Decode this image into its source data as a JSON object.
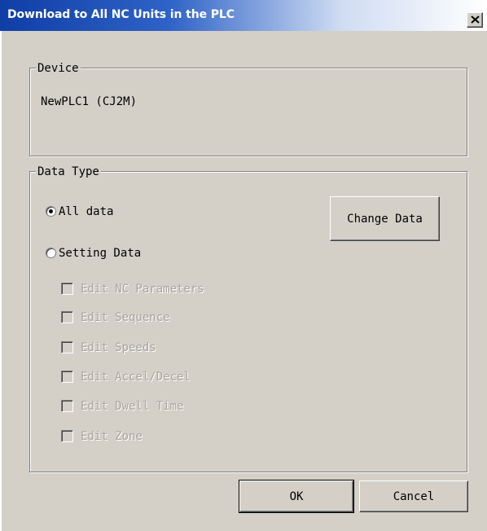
{
  "dialog": {
    "title": "Download to All NC Units in the PLC",
    "close_glyph": "close-icon"
  },
  "device_group": {
    "legend": "Device",
    "value": "NewPLC1 (CJ2M)"
  },
  "data_type_group": {
    "legend": "Data Type",
    "radio_options": [
      {
        "label": "All data",
        "selected": true
      },
      {
        "label": "Setting Data",
        "selected": false
      }
    ],
    "change_data_label": "Change Data",
    "checkboxes": [
      {
        "label": "Edit NC Parameters",
        "checked": false,
        "enabled": false
      },
      {
        "label": "Edit Sequence",
        "checked": false,
        "enabled": false
      },
      {
        "label": "Edit Speeds",
        "checked": false,
        "enabled": false
      },
      {
        "label": "Edit Accel/Decel",
        "checked": false,
        "enabled": false
      },
      {
        "label": "Edit Dwell Time",
        "checked": false,
        "enabled": false
      },
      {
        "label": "Edit Zone",
        "checked": false,
        "enabled": false
      }
    ]
  },
  "buttons": {
    "ok_label": "OK",
    "cancel_label": "Cancel"
  },
  "colors": {
    "face": "#d4d0c8",
    "title_start": "#0f3ea6",
    "disabled_text": "#a8a49c"
  }
}
